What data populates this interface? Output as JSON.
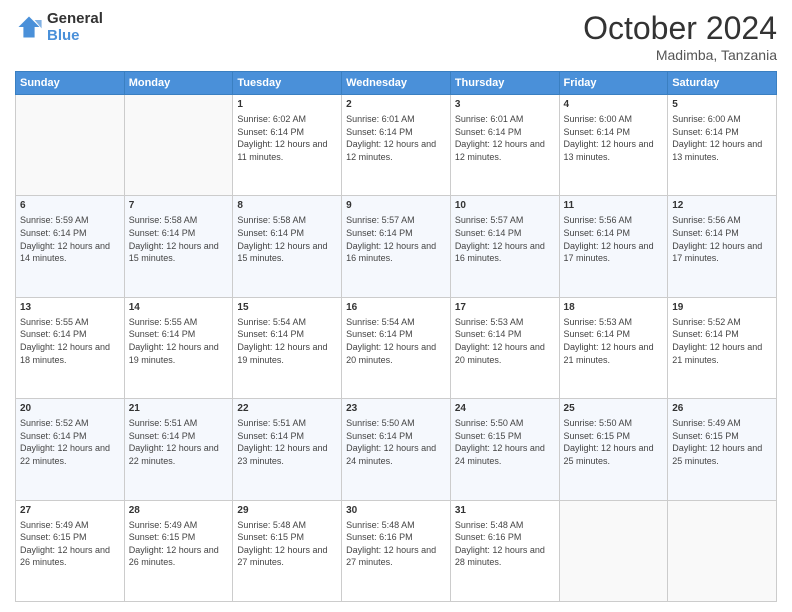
{
  "logo": {
    "line1": "General",
    "line2": "Blue"
  },
  "title": "October 2024",
  "subtitle": "Madimba, Tanzania",
  "headers": [
    "Sunday",
    "Monday",
    "Tuesday",
    "Wednesday",
    "Thursday",
    "Friday",
    "Saturday"
  ],
  "weeks": [
    [
      {
        "day": "",
        "info": ""
      },
      {
        "day": "",
        "info": ""
      },
      {
        "day": "1",
        "info": "Sunrise: 6:02 AM\nSunset: 6:14 PM\nDaylight: 12 hours and 11 minutes."
      },
      {
        "day": "2",
        "info": "Sunrise: 6:01 AM\nSunset: 6:14 PM\nDaylight: 12 hours and 12 minutes."
      },
      {
        "day": "3",
        "info": "Sunrise: 6:01 AM\nSunset: 6:14 PM\nDaylight: 12 hours and 12 minutes."
      },
      {
        "day": "4",
        "info": "Sunrise: 6:00 AM\nSunset: 6:14 PM\nDaylight: 12 hours and 13 minutes."
      },
      {
        "day": "5",
        "info": "Sunrise: 6:00 AM\nSunset: 6:14 PM\nDaylight: 12 hours and 13 minutes."
      }
    ],
    [
      {
        "day": "6",
        "info": "Sunrise: 5:59 AM\nSunset: 6:14 PM\nDaylight: 12 hours and 14 minutes."
      },
      {
        "day": "7",
        "info": "Sunrise: 5:58 AM\nSunset: 6:14 PM\nDaylight: 12 hours and 15 minutes."
      },
      {
        "day": "8",
        "info": "Sunrise: 5:58 AM\nSunset: 6:14 PM\nDaylight: 12 hours and 15 minutes."
      },
      {
        "day": "9",
        "info": "Sunrise: 5:57 AM\nSunset: 6:14 PM\nDaylight: 12 hours and 16 minutes."
      },
      {
        "day": "10",
        "info": "Sunrise: 5:57 AM\nSunset: 6:14 PM\nDaylight: 12 hours and 16 minutes."
      },
      {
        "day": "11",
        "info": "Sunrise: 5:56 AM\nSunset: 6:14 PM\nDaylight: 12 hours and 17 minutes."
      },
      {
        "day": "12",
        "info": "Sunrise: 5:56 AM\nSunset: 6:14 PM\nDaylight: 12 hours and 17 minutes."
      }
    ],
    [
      {
        "day": "13",
        "info": "Sunrise: 5:55 AM\nSunset: 6:14 PM\nDaylight: 12 hours and 18 minutes."
      },
      {
        "day": "14",
        "info": "Sunrise: 5:55 AM\nSunset: 6:14 PM\nDaylight: 12 hours and 19 minutes."
      },
      {
        "day": "15",
        "info": "Sunrise: 5:54 AM\nSunset: 6:14 PM\nDaylight: 12 hours and 19 minutes."
      },
      {
        "day": "16",
        "info": "Sunrise: 5:54 AM\nSunset: 6:14 PM\nDaylight: 12 hours and 20 minutes."
      },
      {
        "day": "17",
        "info": "Sunrise: 5:53 AM\nSunset: 6:14 PM\nDaylight: 12 hours and 20 minutes."
      },
      {
        "day": "18",
        "info": "Sunrise: 5:53 AM\nSunset: 6:14 PM\nDaylight: 12 hours and 21 minutes."
      },
      {
        "day": "19",
        "info": "Sunrise: 5:52 AM\nSunset: 6:14 PM\nDaylight: 12 hours and 21 minutes."
      }
    ],
    [
      {
        "day": "20",
        "info": "Sunrise: 5:52 AM\nSunset: 6:14 PM\nDaylight: 12 hours and 22 minutes."
      },
      {
        "day": "21",
        "info": "Sunrise: 5:51 AM\nSunset: 6:14 PM\nDaylight: 12 hours and 22 minutes."
      },
      {
        "day": "22",
        "info": "Sunrise: 5:51 AM\nSunset: 6:14 PM\nDaylight: 12 hours and 23 minutes."
      },
      {
        "day": "23",
        "info": "Sunrise: 5:50 AM\nSunset: 6:14 PM\nDaylight: 12 hours and 24 minutes."
      },
      {
        "day": "24",
        "info": "Sunrise: 5:50 AM\nSunset: 6:15 PM\nDaylight: 12 hours and 24 minutes."
      },
      {
        "day": "25",
        "info": "Sunrise: 5:50 AM\nSunset: 6:15 PM\nDaylight: 12 hours and 25 minutes."
      },
      {
        "day": "26",
        "info": "Sunrise: 5:49 AM\nSunset: 6:15 PM\nDaylight: 12 hours and 25 minutes."
      }
    ],
    [
      {
        "day": "27",
        "info": "Sunrise: 5:49 AM\nSunset: 6:15 PM\nDaylight: 12 hours and 26 minutes."
      },
      {
        "day": "28",
        "info": "Sunrise: 5:49 AM\nSunset: 6:15 PM\nDaylight: 12 hours and 26 minutes."
      },
      {
        "day": "29",
        "info": "Sunrise: 5:48 AM\nSunset: 6:15 PM\nDaylight: 12 hours and 27 minutes."
      },
      {
        "day": "30",
        "info": "Sunrise: 5:48 AM\nSunset: 6:16 PM\nDaylight: 12 hours and 27 minutes."
      },
      {
        "day": "31",
        "info": "Sunrise: 5:48 AM\nSunset: 6:16 PM\nDaylight: 12 hours and 28 minutes."
      },
      {
        "day": "",
        "info": ""
      },
      {
        "day": "",
        "info": ""
      }
    ]
  ]
}
